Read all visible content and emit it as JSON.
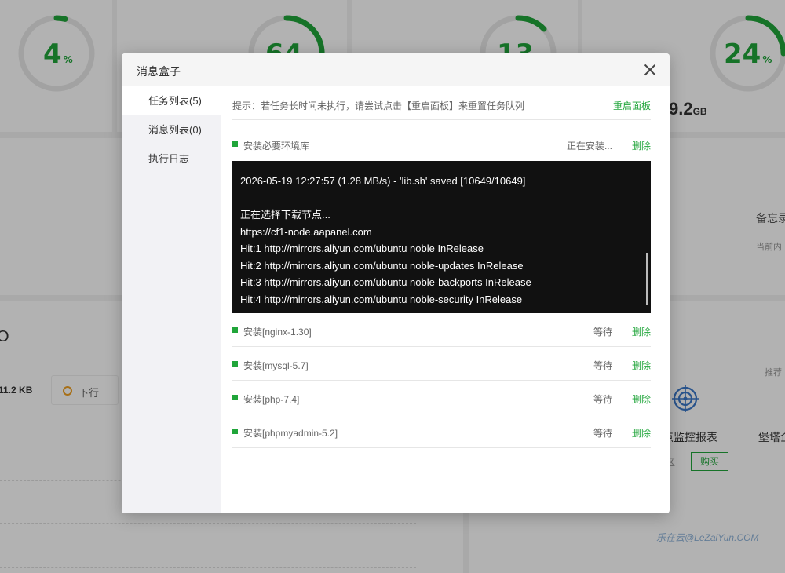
{
  "background": {
    "gauges": [
      {
        "value": "4",
        "unit": "%"
      },
      {
        "value": "64",
        "unit": "%"
      },
      {
        "value": "13",
        "unit": "%"
      },
      {
        "value": "24",
        "unit": "%"
      }
    ],
    "disk_size": "9.2",
    "disk_unit": "GB",
    "memo_title": "备忘录",
    "memo_sub": "当前内",
    "traffic_value": "11.2 KB",
    "download_label": "下行",
    "recommend_label": "推荐",
    "monitor_label": "站点监控报表",
    "bastion_label": "堡塔企",
    "buy_label": "购买",
    "watermark": "乐在云@LeZaiYun.COM",
    "partial_letter": "O",
    "partial_letter2": "区"
  },
  "modal": {
    "title": "消息盒子",
    "sidebar": [
      "任务列表(5)",
      "消息列表(0)",
      "执行日志"
    ],
    "tip": "提示：若任务长时间未执行，请尝试点击【重启面板】来重置任务队列",
    "restart_label": "重启面板",
    "delete_label": "删除",
    "current_task": {
      "name": "安装必要环境库",
      "status": "正在安装..."
    },
    "log_lines": [
      "2026-05-19 12:27:57 (1.28 MB/s) - 'lib.sh' saved [10649/10649]",
      "",
      "正在选择下载节点...",
      "https://cf1-node.aapanel.com",
      "Hit:1 http://mirrors.aliyun.com/ubuntu noble InRelease",
      "Hit:2 http://mirrors.aliyun.com/ubuntu noble-updates InRelease",
      "Hit:3 http://mirrors.aliyun.com/ubuntu noble-backports InRelease",
      "Hit:4 http://mirrors.aliyun.com/ubuntu noble-security InRelease"
    ],
    "tasks": [
      {
        "name": "安装[nginx-1.30]",
        "status": "等待"
      },
      {
        "name": "安装[mysql-5.7]",
        "status": "等待"
      },
      {
        "name": "安装[php-7.4]",
        "status": "等待"
      },
      {
        "name": "安装[phpmyadmin-5.2]",
        "status": "等待"
      }
    ],
    "accent": "#20a53a"
  }
}
